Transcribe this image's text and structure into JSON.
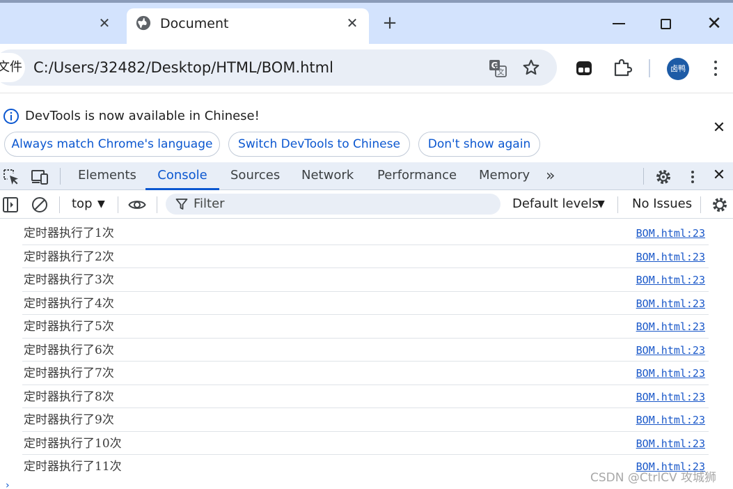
{
  "browser": {
    "active_tab_title": "Document",
    "address_scheme_label": "文件",
    "address_url": "C:/Users/32482/Desktop/HTML/BOM.html",
    "avatar_label": "卤鸭"
  },
  "infobar": {
    "message": "DevTools is now available in Chinese!",
    "buttons": [
      "Always match Chrome's language",
      "Switch DevTools to Chinese",
      "Don't show again"
    ]
  },
  "devtools": {
    "tabs": [
      "Elements",
      "Console",
      "Sources",
      "Network",
      "Performance",
      "Memory"
    ],
    "active_tab": "Console"
  },
  "console_toolbar": {
    "context": "top",
    "filter_placeholder": "Filter",
    "levels": "Default levels",
    "issues": "No Issues"
  },
  "console": {
    "messages": [
      {
        "text": "定时器执行了1次",
        "source": "BOM.html:23"
      },
      {
        "text": "定时器执行了2次",
        "source": "BOM.html:23"
      },
      {
        "text": "定时器执行了3次",
        "source": "BOM.html:23"
      },
      {
        "text": "定时器执行了4次",
        "source": "BOM.html:23"
      },
      {
        "text": "定时器执行了5次",
        "source": "BOM.html:23"
      },
      {
        "text": "定时器执行了6次",
        "source": "BOM.html:23"
      },
      {
        "text": "定时器执行了7次",
        "source": "BOM.html:23"
      },
      {
        "text": "定时器执行了8次",
        "source": "BOM.html:23"
      },
      {
        "text": "定时器执行了9次",
        "source": "BOM.html:23"
      },
      {
        "text": "定时器执行了10次",
        "source": "BOM.html:23"
      },
      {
        "text": "定时器执行了11次",
        "source": "BOM.html:23"
      }
    ]
  },
  "watermark": "CSDN @CtrlCV 攻城狮",
  "colors": {
    "tabstrip": "#d3e3fd",
    "accent": "#0b57d0",
    "link": "#1a58c9",
    "devtools_bar": "#e8eef7"
  },
  "icons": [
    "globe-icon",
    "translate-icon",
    "star-icon",
    "extension-icon",
    "puzzle-icon",
    "info-icon",
    "inspect-icon",
    "device-icon",
    "gear-icon",
    "sidebar-icon",
    "clear-icon",
    "eye-icon",
    "filter-icon",
    "chevron-double-right-icon",
    "close-icon"
  ]
}
